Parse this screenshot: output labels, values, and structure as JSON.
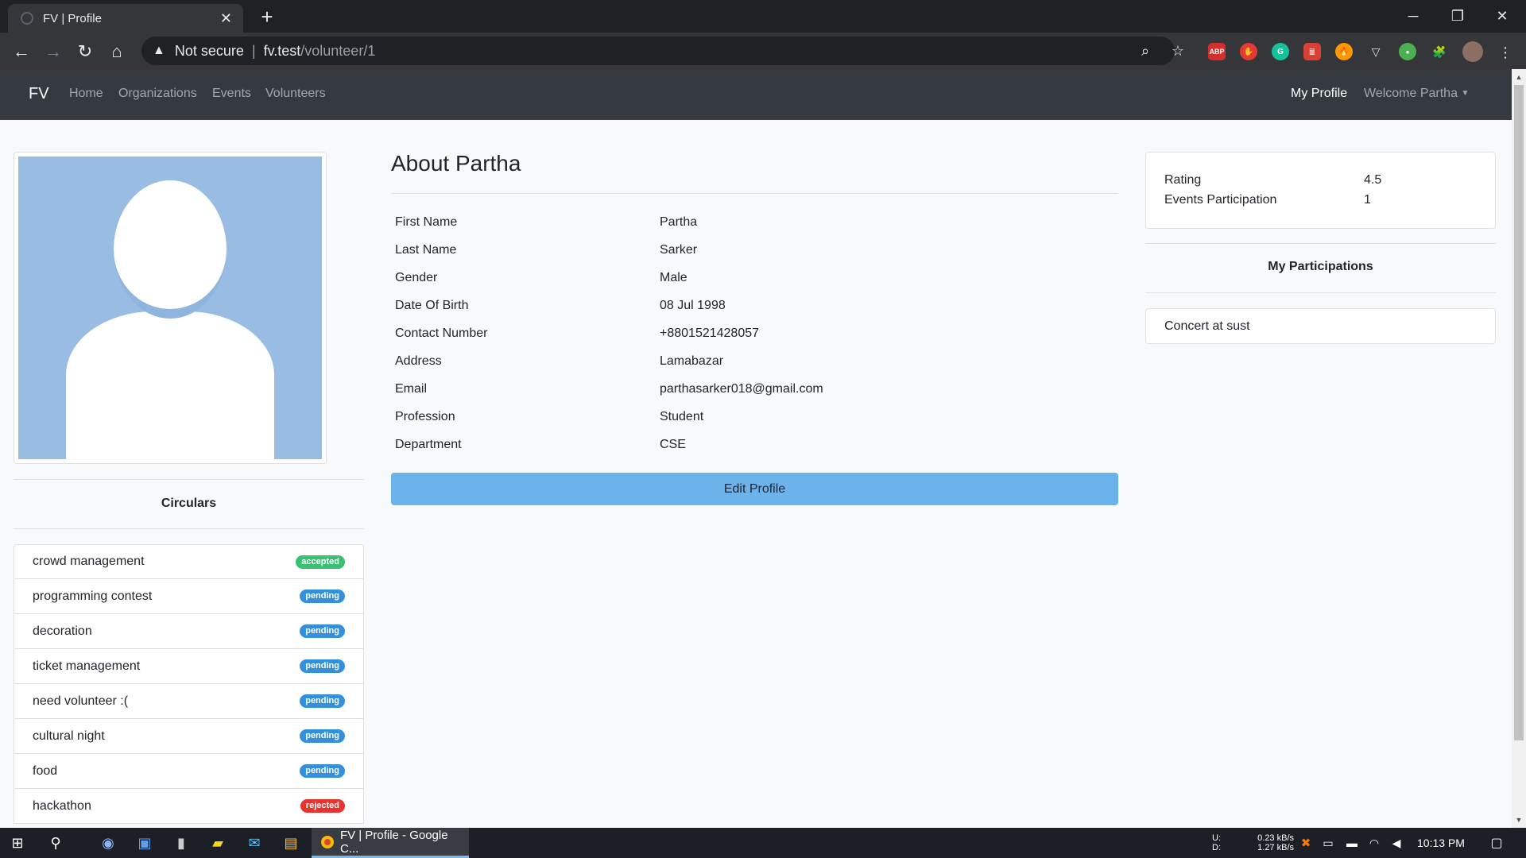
{
  "browser": {
    "tab_title": "FV | Profile",
    "tab_close": "✕",
    "new_tab": "+",
    "security_label": "Not secure",
    "url_host": "fv.test",
    "url_path": "/volunteer/1",
    "extensions": [
      "ABP",
      "✋",
      "G",
      "≣",
      "🔥",
      "▽",
      "●",
      "🧩"
    ]
  },
  "nav": {
    "brand": "FV",
    "links": [
      "Home",
      "Organizations",
      "Events",
      "Volunteers"
    ],
    "my_profile": "My Profile",
    "welcome": "Welcome Partha"
  },
  "circulars": {
    "title": "Circulars",
    "items": [
      {
        "name": "crowd management",
        "status": "accepted"
      },
      {
        "name": "programming contest",
        "status": "pending"
      },
      {
        "name": "decoration",
        "status": "pending"
      },
      {
        "name": "ticket management",
        "status": "pending"
      },
      {
        "name": "need volunteer :(",
        "status": "pending"
      },
      {
        "name": "cultural night",
        "status": "pending"
      },
      {
        "name": "food",
        "status": "pending"
      },
      {
        "name": "hackathon",
        "status": "rejected"
      }
    ]
  },
  "about": {
    "title": "About Partha",
    "rows": [
      {
        "label": "First Name",
        "value": "Partha"
      },
      {
        "label": "Last Name",
        "value": "Sarker"
      },
      {
        "label": "Gender",
        "value": "Male"
      },
      {
        "label": "Date Of Birth",
        "value": "08 Jul 1998"
      },
      {
        "label": "Contact Number",
        "value": "+8801521428057"
      },
      {
        "label": "Address",
        "value": "Lamabazar"
      },
      {
        "label": "Email",
        "value": "parthasarker018@gmail.com"
      },
      {
        "label": "Profession",
        "value": "Student"
      },
      {
        "label": "Department",
        "value": "CSE"
      }
    ],
    "edit_button": "Edit Profile"
  },
  "stats": {
    "rating_label": "Rating",
    "rating_value": "4.5",
    "events_label": "Events Participation",
    "events_value": "1"
  },
  "participations": {
    "title": "My Participations",
    "items": [
      "Concert at sust"
    ]
  },
  "taskbar": {
    "active_app": "FV | Profile - Google C...",
    "net_up_label": "U:",
    "net_down_label": "D:",
    "net_up": "0.23 kB/s",
    "net_down": "1.27 kB/s",
    "time": "10:13 PM"
  },
  "colors": {
    "accepted": "#38c172",
    "pending": "#3490dc",
    "rejected": "#e3342f",
    "edit_button": "#6cb2eb",
    "navbar": "#343a40"
  }
}
